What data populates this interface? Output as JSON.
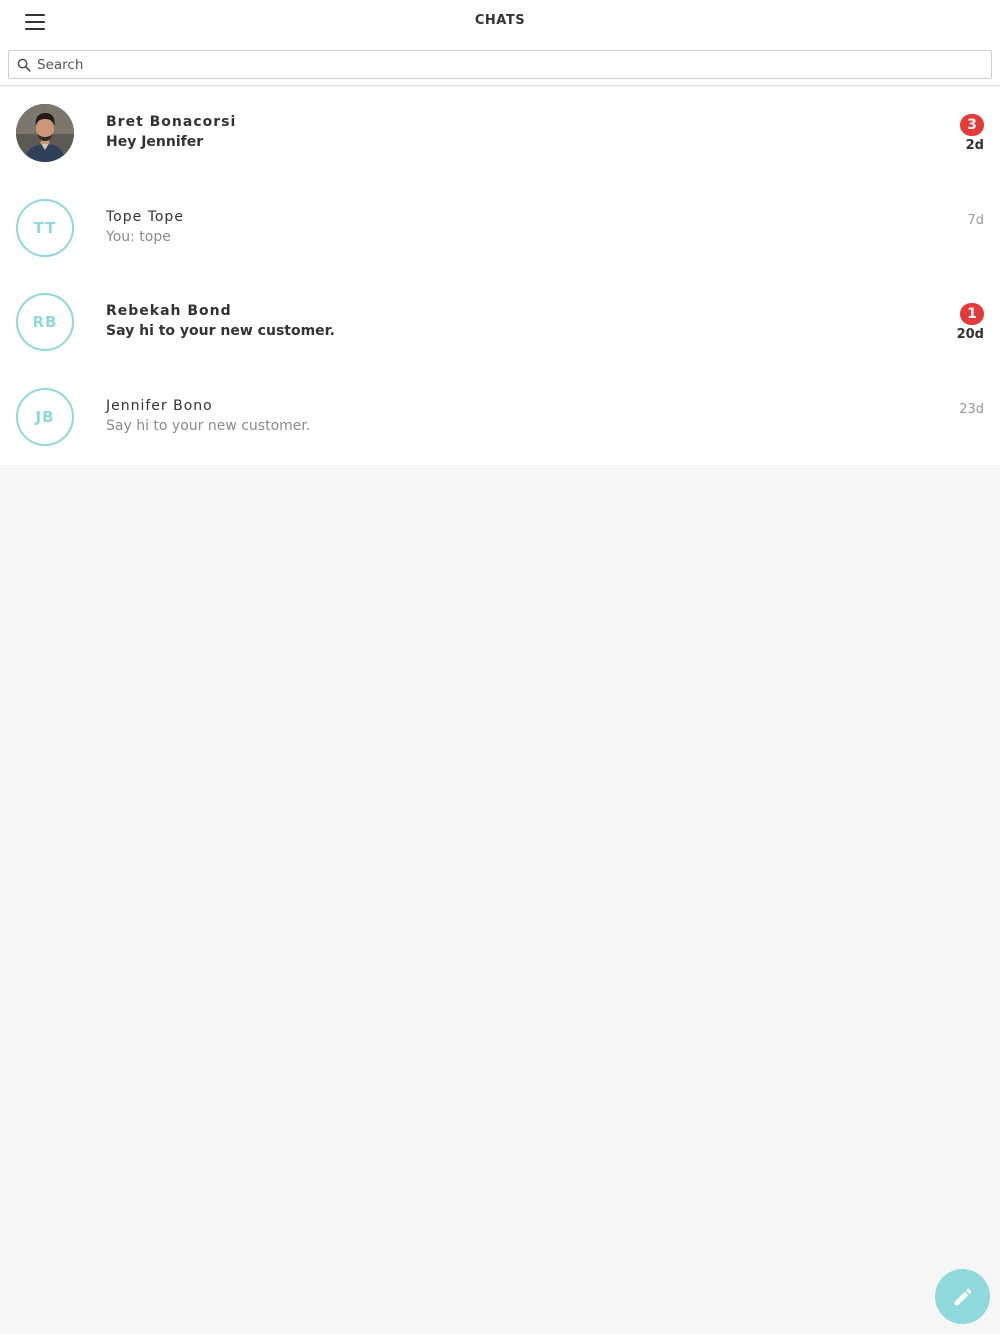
{
  "header": {
    "title": "CHATS",
    "menu_icon": "hamburger-menu-icon"
  },
  "search": {
    "placeholder": "Search",
    "value": "",
    "icon": "search-icon"
  },
  "chats": [
    {
      "name": "Bret Bonacorsi",
      "preview": "Hey Jennifer",
      "time": "2d",
      "unread": "3",
      "avatar": "photo"
    },
    {
      "name": "Tope Tope",
      "preview": "You: tope",
      "time": "7d",
      "avatar_initials": "TT"
    },
    {
      "name": "Rebekah Bond",
      "preview": "Say hi to your new customer.",
      "time": "20d",
      "unread": "1",
      "avatar_initials": "RB"
    },
    {
      "name": "Jennifer Bono",
      "preview": "Say hi to your new customer.",
      "time": "23d",
      "avatar_initials": "JB"
    }
  ],
  "fab": {
    "icon": "pencil-icon"
  },
  "colors": {
    "accent": "#8fd8dc",
    "badge": "#e63a3a",
    "background": "#f6f6f6"
  }
}
